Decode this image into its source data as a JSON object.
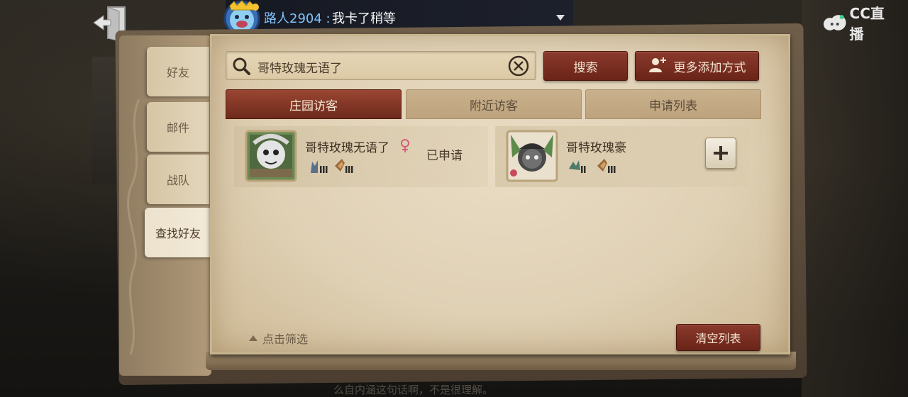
{
  "chat": {
    "user": "路人2904 :",
    "message": "我卡了稍等"
  },
  "platform": {
    "logo_text": "CC直播"
  },
  "side_tabs": [
    {
      "label": "好友"
    },
    {
      "label": "邮件"
    },
    {
      "label": "战队"
    },
    {
      "label": "查找好友"
    }
  ],
  "search": {
    "value": "哥特玫瑰无语了",
    "search_label": "搜索",
    "more_label": "更多添加方式"
  },
  "tabs": [
    {
      "label": "庄园访客",
      "active": true
    },
    {
      "label": "附近访客",
      "active": false
    },
    {
      "label": "申请列表",
      "active": false
    }
  ],
  "visitors": [
    {
      "name": "哥特玫瑰无语了",
      "gender": "female",
      "status": "已申请"
    },
    {
      "name": "哥特玫瑰豪",
      "action": "add"
    }
  ],
  "footer": {
    "filter_label": "点击筛选",
    "clear_label": "清空列表"
  },
  "background": {
    "bottom_text": "么自内涵这句话啊，不是很理解。"
  },
  "colors": {
    "accent_red": "#7a2e20",
    "parchment": "#e2d3b7",
    "chat_user": "#7fc4ff"
  }
}
